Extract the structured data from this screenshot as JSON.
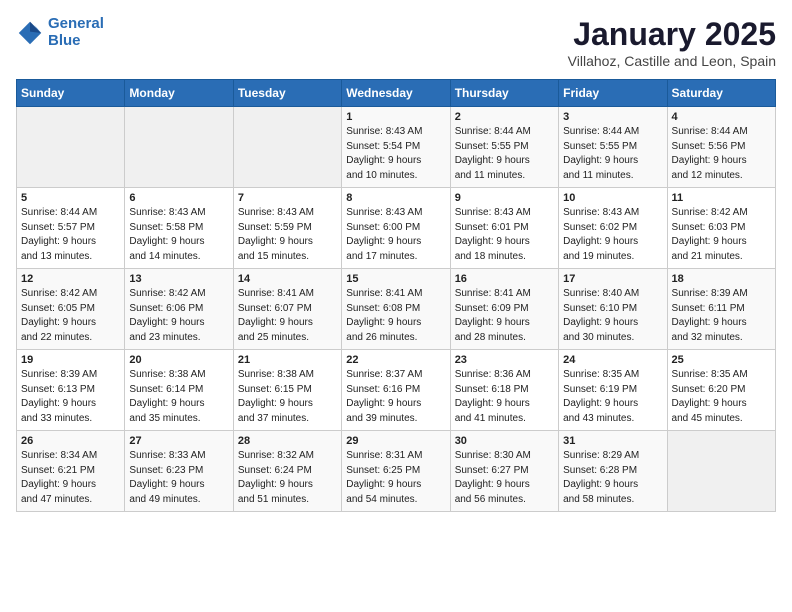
{
  "header": {
    "logo_line1": "General",
    "logo_line2": "Blue",
    "title": "January 2025",
    "subtitle": "Villahoz, Castille and Leon, Spain"
  },
  "weekdays": [
    "Sunday",
    "Monday",
    "Tuesday",
    "Wednesday",
    "Thursday",
    "Friday",
    "Saturday"
  ],
  "weeks": [
    [
      {
        "day": "",
        "info": ""
      },
      {
        "day": "",
        "info": ""
      },
      {
        "day": "",
        "info": ""
      },
      {
        "day": "1",
        "info": "Sunrise: 8:43 AM\nSunset: 5:54 PM\nDaylight: 9 hours\nand 10 minutes."
      },
      {
        "day": "2",
        "info": "Sunrise: 8:44 AM\nSunset: 5:55 PM\nDaylight: 9 hours\nand 11 minutes."
      },
      {
        "day": "3",
        "info": "Sunrise: 8:44 AM\nSunset: 5:55 PM\nDaylight: 9 hours\nand 11 minutes."
      },
      {
        "day": "4",
        "info": "Sunrise: 8:44 AM\nSunset: 5:56 PM\nDaylight: 9 hours\nand 12 minutes."
      }
    ],
    [
      {
        "day": "5",
        "info": "Sunrise: 8:44 AM\nSunset: 5:57 PM\nDaylight: 9 hours\nand 13 minutes."
      },
      {
        "day": "6",
        "info": "Sunrise: 8:43 AM\nSunset: 5:58 PM\nDaylight: 9 hours\nand 14 minutes."
      },
      {
        "day": "7",
        "info": "Sunrise: 8:43 AM\nSunset: 5:59 PM\nDaylight: 9 hours\nand 15 minutes."
      },
      {
        "day": "8",
        "info": "Sunrise: 8:43 AM\nSunset: 6:00 PM\nDaylight: 9 hours\nand 17 minutes."
      },
      {
        "day": "9",
        "info": "Sunrise: 8:43 AM\nSunset: 6:01 PM\nDaylight: 9 hours\nand 18 minutes."
      },
      {
        "day": "10",
        "info": "Sunrise: 8:43 AM\nSunset: 6:02 PM\nDaylight: 9 hours\nand 19 minutes."
      },
      {
        "day": "11",
        "info": "Sunrise: 8:42 AM\nSunset: 6:03 PM\nDaylight: 9 hours\nand 21 minutes."
      }
    ],
    [
      {
        "day": "12",
        "info": "Sunrise: 8:42 AM\nSunset: 6:05 PM\nDaylight: 9 hours\nand 22 minutes."
      },
      {
        "day": "13",
        "info": "Sunrise: 8:42 AM\nSunset: 6:06 PM\nDaylight: 9 hours\nand 23 minutes."
      },
      {
        "day": "14",
        "info": "Sunrise: 8:41 AM\nSunset: 6:07 PM\nDaylight: 9 hours\nand 25 minutes."
      },
      {
        "day": "15",
        "info": "Sunrise: 8:41 AM\nSunset: 6:08 PM\nDaylight: 9 hours\nand 26 minutes."
      },
      {
        "day": "16",
        "info": "Sunrise: 8:41 AM\nSunset: 6:09 PM\nDaylight: 9 hours\nand 28 minutes."
      },
      {
        "day": "17",
        "info": "Sunrise: 8:40 AM\nSunset: 6:10 PM\nDaylight: 9 hours\nand 30 minutes."
      },
      {
        "day": "18",
        "info": "Sunrise: 8:39 AM\nSunset: 6:11 PM\nDaylight: 9 hours\nand 32 minutes."
      }
    ],
    [
      {
        "day": "19",
        "info": "Sunrise: 8:39 AM\nSunset: 6:13 PM\nDaylight: 9 hours\nand 33 minutes."
      },
      {
        "day": "20",
        "info": "Sunrise: 8:38 AM\nSunset: 6:14 PM\nDaylight: 9 hours\nand 35 minutes."
      },
      {
        "day": "21",
        "info": "Sunrise: 8:38 AM\nSunset: 6:15 PM\nDaylight: 9 hours\nand 37 minutes."
      },
      {
        "day": "22",
        "info": "Sunrise: 8:37 AM\nSunset: 6:16 PM\nDaylight: 9 hours\nand 39 minutes."
      },
      {
        "day": "23",
        "info": "Sunrise: 8:36 AM\nSunset: 6:18 PM\nDaylight: 9 hours\nand 41 minutes."
      },
      {
        "day": "24",
        "info": "Sunrise: 8:35 AM\nSunset: 6:19 PM\nDaylight: 9 hours\nand 43 minutes."
      },
      {
        "day": "25",
        "info": "Sunrise: 8:35 AM\nSunset: 6:20 PM\nDaylight: 9 hours\nand 45 minutes."
      }
    ],
    [
      {
        "day": "26",
        "info": "Sunrise: 8:34 AM\nSunset: 6:21 PM\nDaylight: 9 hours\nand 47 minutes."
      },
      {
        "day": "27",
        "info": "Sunrise: 8:33 AM\nSunset: 6:23 PM\nDaylight: 9 hours\nand 49 minutes."
      },
      {
        "day": "28",
        "info": "Sunrise: 8:32 AM\nSunset: 6:24 PM\nDaylight: 9 hours\nand 51 minutes."
      },
      {
        "day": "29",
        "info": "Sunrise: 8:31 AM\nSunset: 6:25 PM\nDaylight: 9 hours\nand 54 minutes."
      },
      {
        "day": "30",
        "info": "Sunrise: 8:30 AM\nSunset: 6:27 PM\nDaylight: 9 hours\nand 56 minutes."
      },
      {
        "day": "31",
        "info": "Sunrise: 8:29 AM\nSunset: 6:28 PM\nDaylight: 9 hours\nand 58 minutes."
      },
      {
        "day": "",
        "info": ""
      }
    ]
  ]
}
